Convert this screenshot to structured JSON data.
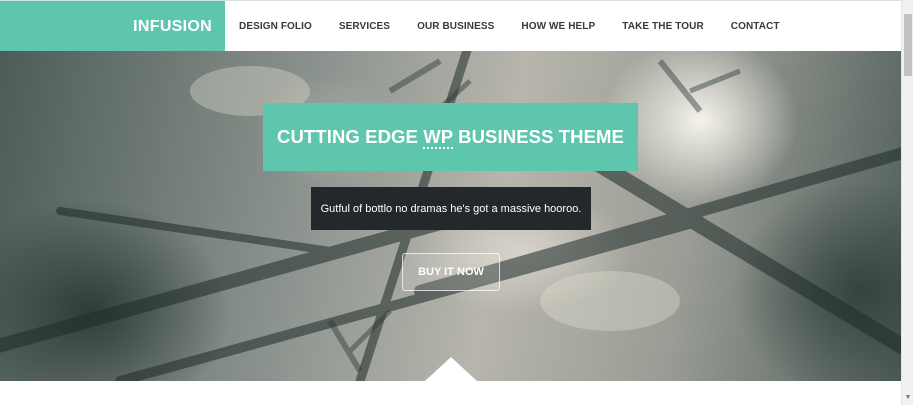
{
  "brand": {
    "name": "INFUSION",
    "accent_color": "#5fc6ae"
  },
  "nav": {
    "items": [
      {
        "label": "DESIGN FOLIO"
      },
      {
        "label": "SERVICES"
      },
      {
        "label": "OUR BUSINESS"
      },
      {
        "label": "HOW WE HELP"
      },
      {
        "label": "TAKE THE TOUR"
      },
      {
        "label": "CONTACT"
      }
    ]
  },
  "hero": {
    "title_before": "CUTTING EDGE ",
    "title_abbr": "WP",
    "title_after": " BUSINESS THEME",
    "subtitle": "Gutful of bottlo no dramas he's got a massive hooroo.",
    "cta_label": "BUY IT NOW"
  },
  "icons": {
    "scroll_down": "chevron-down-icon"
  }
}
